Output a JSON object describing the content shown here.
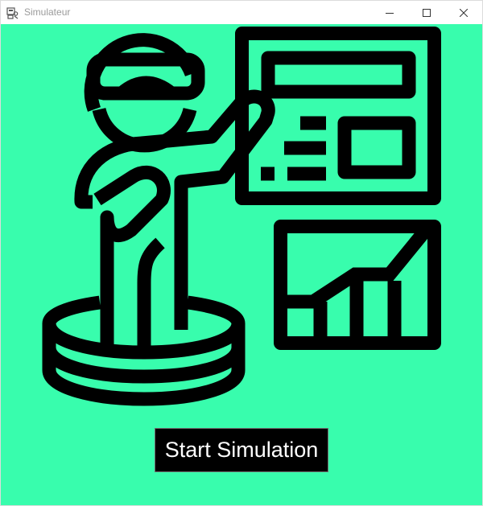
{
  "window": {
    "title": "Simulateur",
    "controls": {
      "minimize_icon": "minimize-icon",
      "maximize_icon": "maximize-icon",
      "close_icon": "close-icon"
    }
  },
  "colors": {
    "background": "#38fdad",
    "ink": "#000000",
    "button_text": "#ffffff"
  },
  "illustration": {
    "icon": "vr-simulation-presenter-icon"
  },
  "main": {
    "start_button_label": "Start Simulation"
  }
}
